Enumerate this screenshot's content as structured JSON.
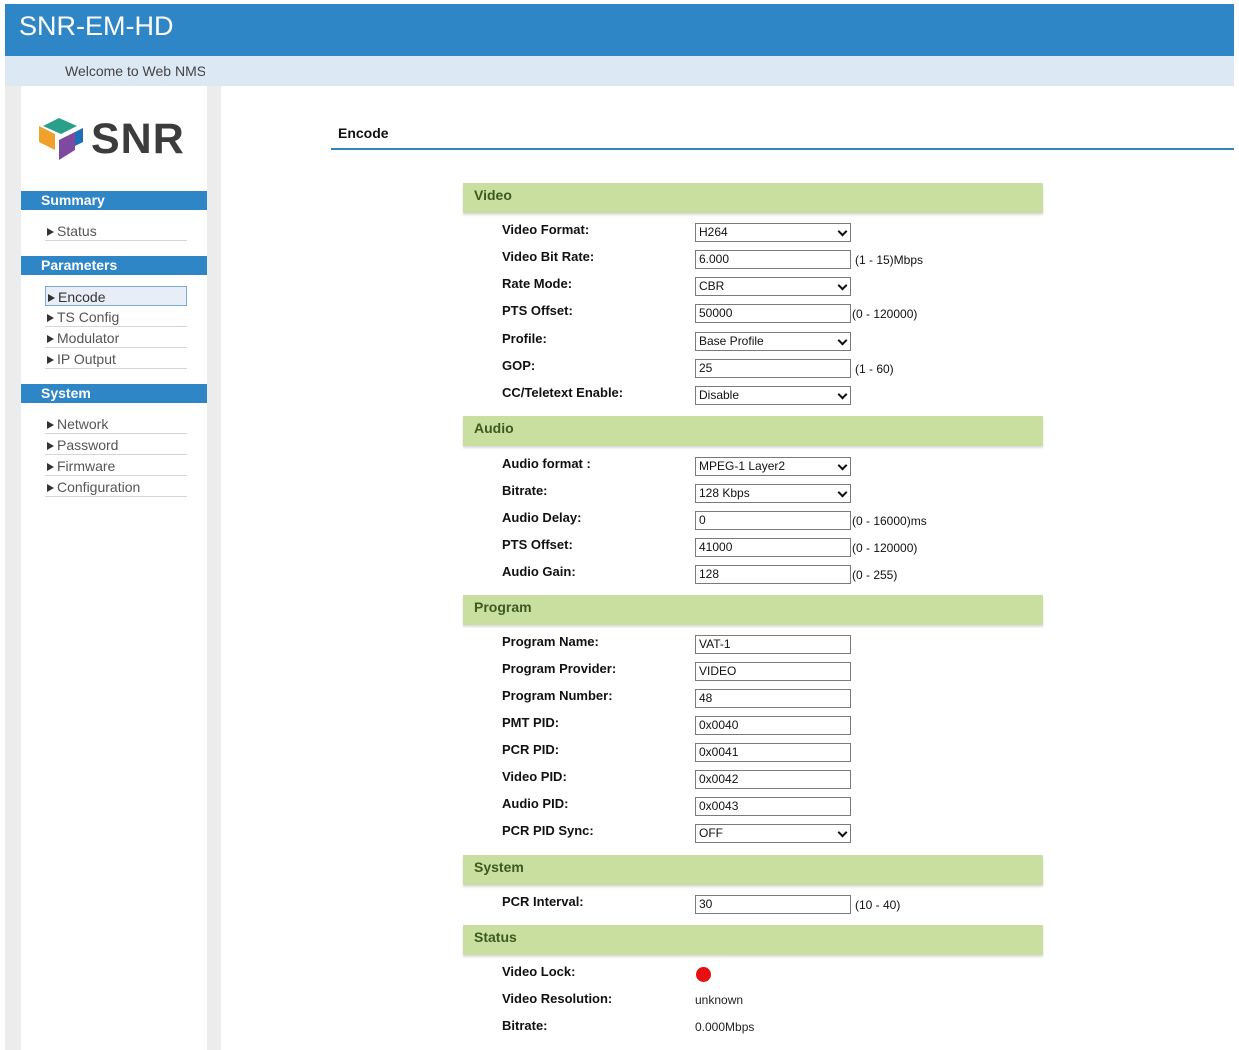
{
  "app": {
    "title": "SNR-EM-HD",
    "welcome": "Welcome to Web NMS"
  },
  "logo": {
    "text": "SNR",
    "colors": [
      "#f0a12b",
      "#2aa08a",
      "#7e4aa0",
      "#1d6fb8"
    ]
  },
  "sidebar": {
    "summary": {
      "title": "Summary",
      "items": [
        {
          "label": "Status"
        }
      ]
    },
    "parameters": {
      "title": "Parameters",
      "items": [
        {
          "label": "Encode",
          "active": true
        },
        {
          "label": "TS Config"
        },
        {
          "label": "Modulator"
        },
        {
          "label": "IP Output"
        }
      ]
    },
    "system": {
      "title": "System",
      "items": [
        {
          "label": "Network"
        },
        {
          "label": "Password"
        },
        {
          "label": "Firmware"
        },
        {
          "label": "Configuration"
        }
      ]
    }
  },
  "page": {
    "title": "Encode"
  },
  "video": {
    "title": "Video",
    "format": {
      "label": "Video Format:",
      "value": "H264"
    },
    "bitrate": {
      "label": "Video Bit Rate:",
      "value": "6.000",
      "hint": "(1 - 15)Mbps"
    },
    "rate_mode": {
      "label": "Rate Mode:",
      "value": "CBR"
    },
    "pts_offset": {
      "label": "PTS Offset:",
      "value": "50000",
      "hint": "(0 - 120000)"
    },
    "profile": {
      "label": "Profile:",
      "value": "Base Profile"
    },
    "gop": {
      "label": "GOP:",
      "value": "25",
      "hint": "(1 - 60)"
    },
    "cc": {
      "label": "CC/Teletext Enable:",
      "value": "Disable"
    }
  },
  "audio": {
    "title": "Audio",
    "format": {
      "label": "Audio format :",
      "value": "MPEG-1 Layer2"
    },
    "bitrate": {
      "label": "Bitrate:",
      "value": "128 Kbps"
    },
    "delay": {
      "label": "Audio Delay:",
      "value": "0",
      "hint": "(0 - 16000)ms"
    },
    "pts_offset": {
      "label": "PTS Offset:",
      "value": "41000",
      "hint": "(0 - 120000)"
    },
    "gain": {
      "label": "Audio Gain:",
      "value": "128",
      "hint": "(0 - 255)"
    }
  },
  "program": {
    "title": "Program",
    "name": {
      "label": "Program Name:",
      "value": "VAT-1"
    },
    "provider": {
      "label": "Program Provider:",
      "value": "VIDEO"
    },
    "number": {
      "label": "Program Number:",
      "value": "48"
    },
    "pmt_pid": {
      "label": "PMT PID:",
      "value": "0x0040"
    },
    "pcr_pid": {
      "label": "PCR PID:",
      "value": "0x0041"
    },
    "video_pid": {
      "label": "Video PID:",
      "value": "0x0042"
    },
    "audio_pid": {
      "label": "Audio PID:",
      "value": "0x0043"
    },
    "pcr_sync": {
      "label": "PCR PID Sync:",
      "value": "OFF"
    }
  },
  "system": {
    "title": "System",
    "pcr_interval": {
      "label": "PCR Interval:",
      "value": "30",
      "hint": "(10 - 40)"
    }
  },
  "status": {
    "title": "Status",
    "video_lock": {
      "label": "Video Lock:",
      "state_color": "#e81010"
    },
    "resolution": {
      "label": "Video Resolution:",
      "value": "unknown"
    },
    "bitrate": {
      "label": "Bitrate:",
      "value": "0.000Mbps"
    }
  }
}
